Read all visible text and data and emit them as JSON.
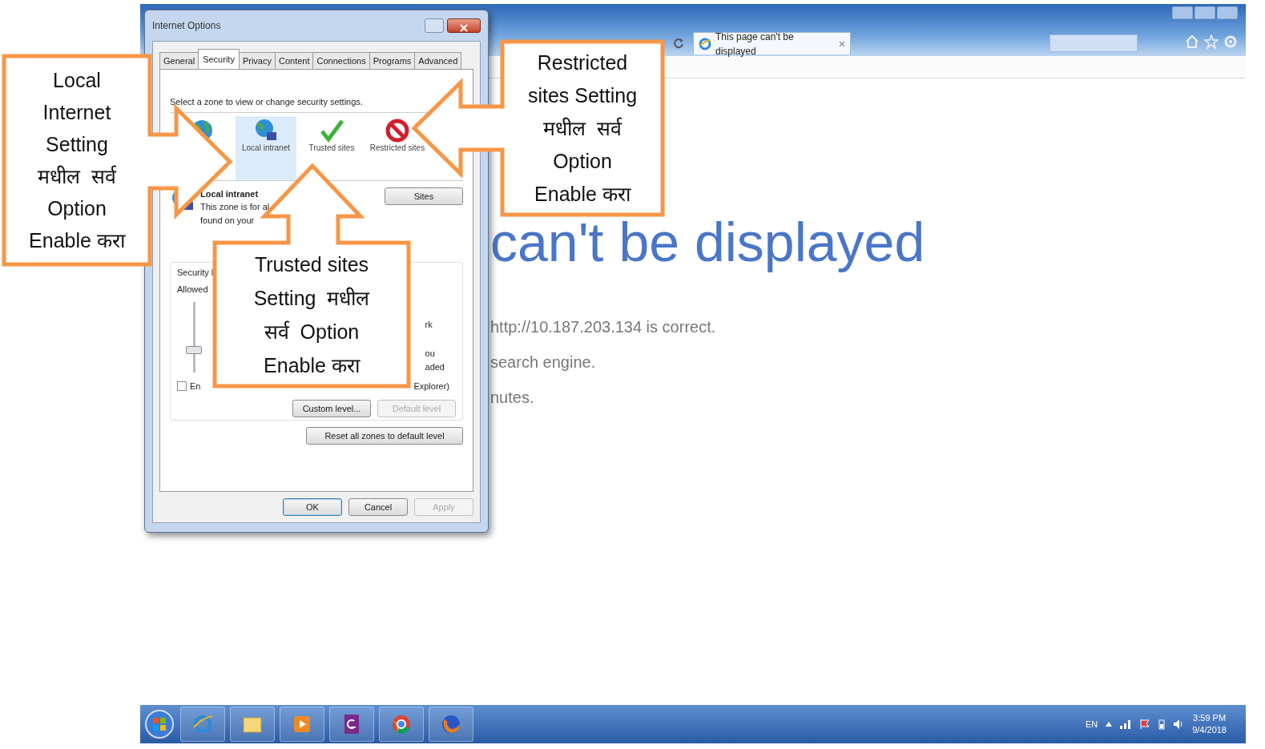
{
  "browser": {
    "tab_title": "This page can't be displayed",
    "heading": "can't be displayed",
    "lines": [
      "http://10.187.203.134 is correct.",
      "search engine.",
      "nutes."
    ]
  },
  "dialog": {
    "title": "Internet Options",
    "tabs": [
      {
        "label": "General",
        "selected": false
      },
      {
        "label": "Security",
        "selected": true
      },
      {
        "label": "Privacy",
        "selected": false
      },
      {
        "label": "Content",
        "selected": false
      },
      {
        "label": "Connections",
        "selected": false
      },
      {
        "label": "Programs",
        "selected": false
      },
      {
        "label": "Advanced",
        "selected": false
      }
    ],
    "zone_prompt": "Select a zone to view or change security settings.",
    "zones": [
      {
        "kind": "internet",
        "selected": false
      },
      {
        "kind": "intranet",
        "label": "Local intranet",
        "selected": true
      },
      {
        "kind": "trusted",
        "label": "Trusted sites",
        "selected": false
      },
      {
        "kind": "restricted",
        "label": "Restricted sites",
        "selected": false
      }
    ],
    "zone_name": "Local intranet",
    "zone_description": [
      "This zone is for al",
      "found on your"
    ],
    "sites_button": "Sites",
    "security_label": "Security l",
    "allowed_label": "Allowed",
    "slider": {
      "level": 0.3
    },
    "side_fragments": [
      "rk",
      "ou",
      "aded"
    ],
    "protected_mode": {
      "label_start": "En",
      "label_end": "Explorer)",
      "checked": false
    },
    "custom_button": {
      "label": "Custom level...",
      "disabled": false
    },
    "default_button": {
      "label": "Default level",
      "disabled": true
    },
    "reset_button": "Reset all zones to default level",
    "footer_buttons": [
      {
        "label": "OK",
        "disabled": false
      },
      {
        "label": "Cancel",
        "disabled": false
      },
      {
        "label": "Apply",
        "disabled": true
      }
    ]
  },
  "callouts": [
    {
      "kind": "right",
      "lines": [
        "Local",
        "Internet",
        "Setting",
        "मधील  सर्व",
        "Option",
        "Enable करा"
      ]
    },
    {
      "kind": "left",
      "lines": [
        "Restricted",
        "sites Setting",
        "मधील  सर्व",
        "Option",
        "Enable करा"
      ]
    },
    {
      "kind": "up",
      "lines": [
        "Trusted sites",
        "Setting  मधील",
        "सर्व  Option",
        "Enable करा"
      ]
    }
  ],
  "taskbar": {
    "language": "EN",
    "time": "3:59 PM",
    "date": "9/4/2018"
  }
}
